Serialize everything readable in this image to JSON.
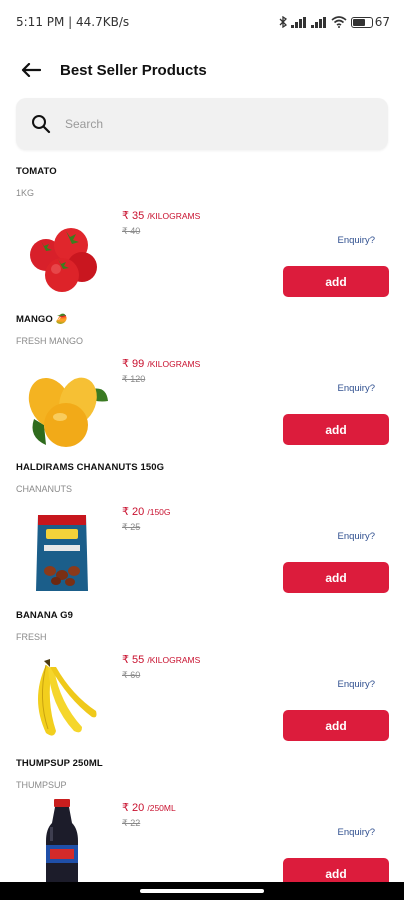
{
  "status_bar": {
    "time_speed": "5:11 PM | 44.7KB/s",
    "battery_level": "67"
  },
  "header": {
    "title": "Best Seller Products"
  },
  "search": {
    "placeholder": "Search"
  },
  "colors": {
    "accent": "#dc1c3c",
    "price": "#c8102e",
    "enquiry": "#2f4f8f"
  },
  "products": [
    {
      "name": "TOMATO",
      "subtitle": "1KG",
      "price": "₹ 35",
      "unit": "/KILOGRAMS",
      "mrp": "₹ 40",
      "enquiry": "Enquiry?",
      "add_label": "add",
      "image_icon": "tomato-image"
    },
    {
      "name": "MANGO 🥭",
      "subtitle": "FRESH MANGO",
      "price": "₹ 99",
      "unit": "/KILOGRAMS",
      "mrp": "₹ 120",
      "enquiry": "Enquiry?",
      "add_label": "add",
      "image_icon": "mango-image"
    },
    {
      "name": "HALDIRAMS CHANANUTS 150G",
      "subtitle": "CHANANUTS",
      "price": "₹ 20",
      "unit": "/150G",
      "mrp": "₹ 25",
      "enquiry": "Enquiry?",
      "add_label": "add",
      "image_icon": "snack-pack-image"
    },
    {
      "name": "BANANA G9",
      "subtitle": "FRESH",
      "price": "₹ 55",
      "unit": "/KILOGRAMS",
      "mrp": "₹ 60",
      "enquiry": "Enquiry?",
      "add_label": "add",
      "image_icon": "banana-image"
    },
    {
      "name": "THUMPSUP 250ML",
      "subtitle": "THUMPSUP",
      "price": "₹ 20",
      "unit": "/250ML",
      "mrp": "₹ 22",
      "enquiry": "Enquiry?",
      "add_label": "add",
      "image_icon": "soda-bottle-image"
    }
  ]
}
